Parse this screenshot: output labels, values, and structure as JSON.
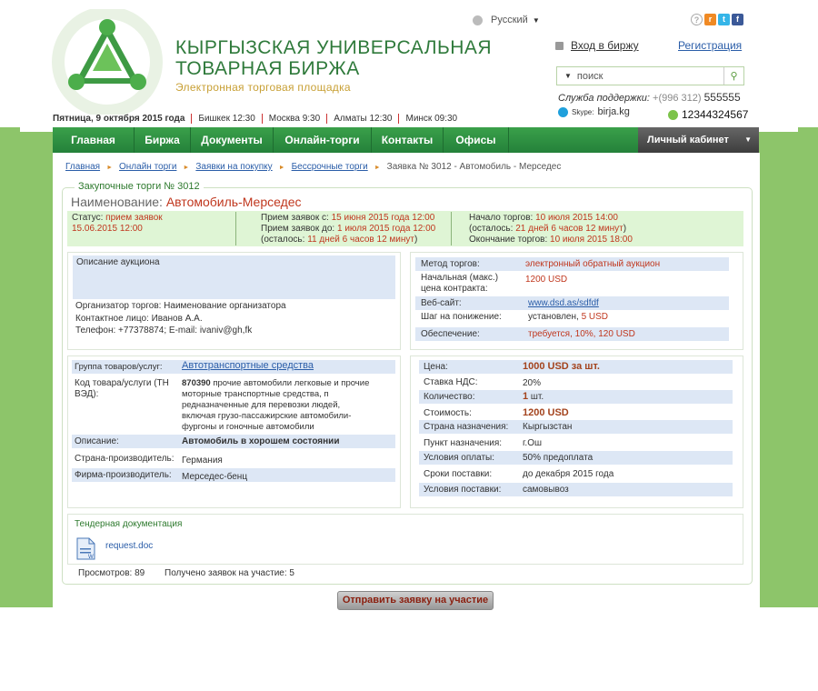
{
  "header": {
    "title_line1": "КЫРГЫЗСКАЯ УНИВЕРСАЛЬНАЯ",
    "title_line2": "ТОВАРНАЯ БИРЖА",
    "subtitle": "Электронная торговая площадка",
    "date": "Пятница, 9 октября 2015 года",
    "clocks": [
      "Бишкек 12:30",
      "Москва 9:30",
      "Алматы 12:30",
      "Минск 09:30"
    ],
    "language": "Русский",
    "login": "Вход в биржу",
    "register": "Регистрация",
    "search_placeholder": "поиск",
    "support_label": "Служба поддержки:",
    "support_code": "+(996 312)",
    "support_number": "555555",
    "skype_label": "Skype:",
    "skype": "birja.kg",
    "icq": "12344324567"
  },
  "nav": {
    "items": [
      "Главная",
      "Биржа",
      "Документы",
      "Онлайн-торги",
      "Контакты",
      "Офисы"
    ],
    "cabinet": "Личный кабинет"
  },
  "breadcrumb": [
    "Главная",
    "Онлайн торги",
    "Заявки на покупку",
    "Бессрочные торги",
    "Заявка № 3012 - Автомобиль - Мерседес"
  ],
  "panel": {
    "legend": "Закупочные торги № 3012",
    "name_label": "Наименование:",
    "name_value": "Автомобиль-Мерседес",
    "status_label": "Статус:",
    "status_value": "прием заявок",
    "status_date": "15.06.2015 12:00",
    "accept_from_label": "Прием заявок с:",
    "accept_from": "15 июня 2015 года 12:00",
    "accept_to_label": "Прием заявок до:",
    "accept_to": "1 июля 2015 года 12:00",
    "accept_left_pre": "(осталось:",
    "accept_left": "11 дней 6 часов 12 минут",
    "accept_left_post": ")",
    "start_label": "Начало торгов:",
    "start": "10 июля 2015 14:00",
    "start_left_pre": "(осталось:",
    "start_left": "21 дней 6 часов 12 минут",
    "start_left_post": ")",
    "end_label": "Окончание торгов:",
    "end": "10 июля 2015 18:00"
  },
  "auction": {
    "desc_label": "Описание аукциона",
    "organizer": "Организатор торгов: Наименование организатора",
    "contact": "Контактное лицо: Иванов А.А.",
    "phone": "Телефон: +77378874; E-mail: ivaniv@gh,fk"
  },
  "method": {
    "rows": [
      {
        "label": "Метод торгов:",
        "value": "электронный обратный аукцион"
      },
      {
        "label": "Начальная (макс.) цена контракта:",
        "value": "1200 USD"
      },
      {
        "label": "Веб-сайт:",
        "value": "www.dsd.as/sdfdf"
      },
      {
        "label": "Шаг на понижение:",
        "value_pre": "установлен,",
        "value": "5 USD"
      },
      {
        "label": "Обеспечение:",
        "value": "требуется, 10%, 120 USD"
      }
    ]
  },
  "goods": {
    "group_label": "Группа товаров/услуг:",
    "group_value": "Автотранспортные средства",
    "code_label": "Код товара/услуги (ТН ВЭД):",
    "code_num": "870390",
    "code_desc": "прочие автомобили легковые и прочие моторные транспортные средства, п редназначенные для перевозки людей, включая грузо-пассажирские автомобили-фургоны и гоночные автомобили",
    "desc_label": "Описание:",
    "desc_value": "Автомобиль в хорошем состоянии",
    "country_label": "Страна-производитель:",
    "country_value": "Германия",
    "maker_label": "Фирма-производитель:",
    "maker_value": "Мерседес-бенц"
  },
  "price": {
    "rows": [
      {
        "label": "Цена:",
        "value": "1000 USD за шт."
      },
      {
        "label": "Ставка НДС:",
        "value": "20%"
      },
      {
        "label": "Количество:",
        "value_num": "1",
        "value": "шт."
      },
      {
        "label": "Стоимость:",
        "value": "1200 USD"
      },
      {
        "label": "Страна назначения:",
        "value": "Кыргызстан"
      },
      {
        "label": "Пункт назначения:",
        "value": "г.Ош"
      },
      {
        "label": "Условия оплаты:",
        "value": "50% предоплата"
      },
      {
        "label": "Сроки поставки:",
        "value": "до декабря 2015 года"
      },
      {
        "label": "Условия поставки:",
        "value": "самовывоз"
      }
    ]
  },
  "docs": {
    "title": "Тендерная документация",
    "file": "request.doc"
  },
  "stats": {
    "views": "Просмотров: 89",
    "applications": "Получено заявок на участие: 5"
  },
  "submit_label": "Отправить заявку на участие",
  "colors": {
    "brand_green": "#2f7a3b",
    "nav_green": "#2e8f40",
    "page_bg": "#8dc56a",
    "red": "#c0371e",
    "highlight": "#dde7f5"
  }
}
